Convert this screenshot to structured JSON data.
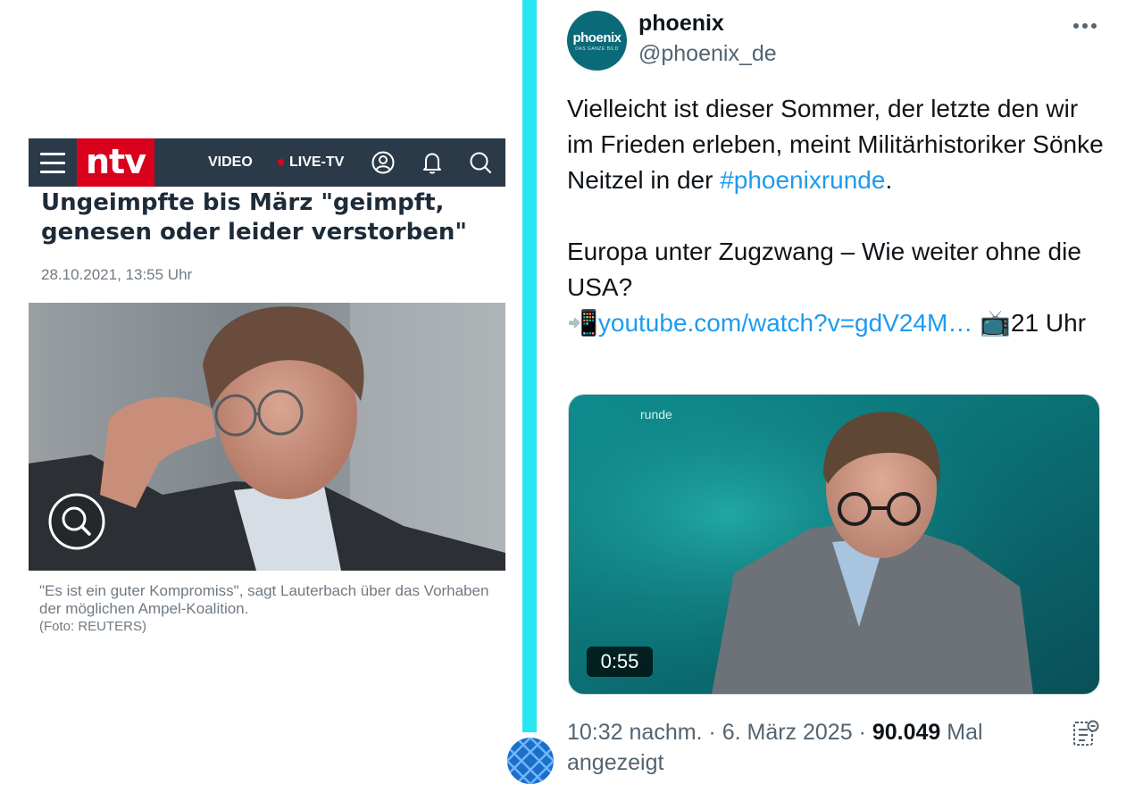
{
  "ntv": {
    "logo_text": "ntv",
    "nav_video": "VIDEO",
    "nav_live": "LIVE-TV",
    "brand_color": "#d9001c",
    "bar_color": "#2b3a48"
  },
  "article": {
    "headline": "Ungeimpfte bis März \"geimpft, genesen oder leider verstorben\"",
    "date": "28.10.2021, 13:55 Uhr",
    "caption": "\"Es ist ein guter Kompromiss\", sagt Lauterbach über das Vorhaben der möglichen Ampel-Koalition.",
    "photo_credit": "(Foto: REUTERS)"
  },
  "tweet": {
    "avatar_text": "phoenix",
    "avatar_subtext": "DAS GANZE BILD",
    "display_name": "phoenix",
    "handle": "@phoenix_de",
    "text_line1_a": "Vielleicht ist dieser Sommer, der letzte den wir im Frieden erleben, meint Militärhistoriker Sönke Neitzel in der ",
    "hashtag": "#phoenixrunde",
    "text_line1_b": ".",
    "text_para2": "Europa unter Zugzwang – Wie weiter ohne die USA?",
    "emoji_phone": "📲",
    "link": "youtube.com/watch?v=gdV24M…",
    "emoji_tv": "📺",
    "time_text": "21 Uhr",
    "media_label": "runde",
    "video_duration": "0:55",
    "timestamp": "10:32 nachm. · 6. März 2025 · ",
    "views_count": "90.049",
    "views_label": " Mal angezeigt",
    "accent_color": "#1d9bf0"
  },
  "divider_color": "#29e6f3"
}
